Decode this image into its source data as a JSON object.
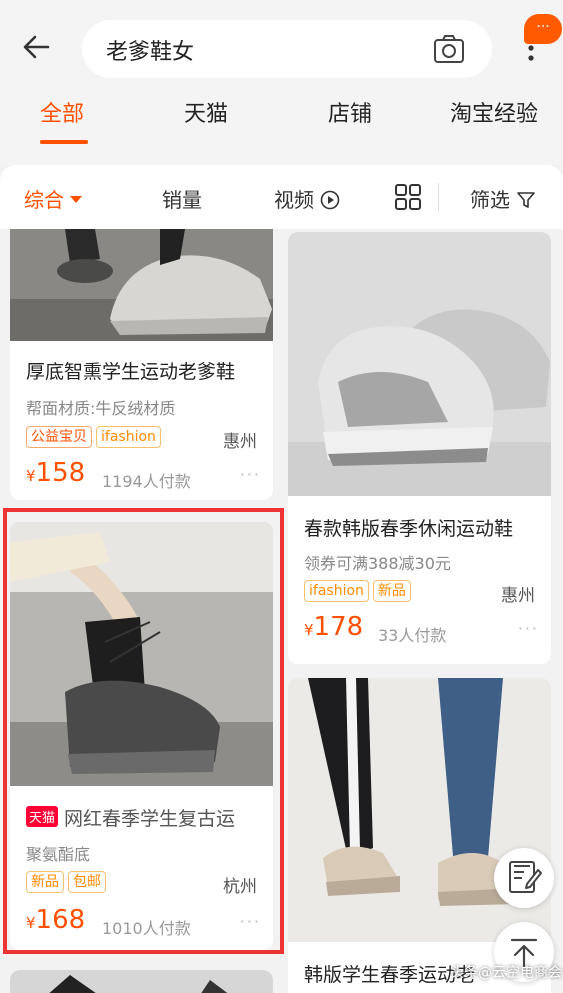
{
  "search": {
    "query": "老爹鞋女"
  },
  "badge": "···",
  "tabs": [
    {
      "label": "全部",
      "active": true
    },
    {
      "label": "天猫",
      "active": false
    },
    {
      "label": "店铺",
      "active": false
    },
    {
      "label": "淘宝经验",
      "active": false
    }
  ],
  "filters": {
    "sort": "综合",
    "sales": "销量",
    "video": "视频",
    "filter": "筛选"
  },
  "products": [
    {
      "title": "厚底智熏学生运动老爹鞋",
      "subtitle": "帮面材质:牛反绒材质",
      "tags": [
        "公益宝贝",
        "ifashion"
      ],
      "city": "惠州",
      "yen": "¥",
      "price": "158",
      "paid": "1194人付款",
      "more": "···"
    },
    {
      "title": "春款韩版春季休闲运动鞋",
      "subtitle": "领券可满388减30元",
      "tags": [
        "ifashion",
        "新品"
      ],
      "city": "惠州",
      "yen": "¥",
      "price": "178",
      "paid": "33人付款",
      "more": "···"
    },
    {
      "badge": "天猫",
      "title": "网红春季学生复古运",
      "subtitle": "聚氨酯底",
      "tags": [
        "新品",
        "包邮"
      ],
      "city": "杭州",
      "yen": "¥",
      "price": "168",
      "paid": "1010人付款",
      "more": "···"
    },
    {
      "title": "韩版学生春季运动老"
    }
  ],
  "watermark": "头条@云空电商会",
  "colors": {
    "accent": "#ff5000",
    "highlight": "#e33333",
    "tmall": "#ff0036"
  }
}
